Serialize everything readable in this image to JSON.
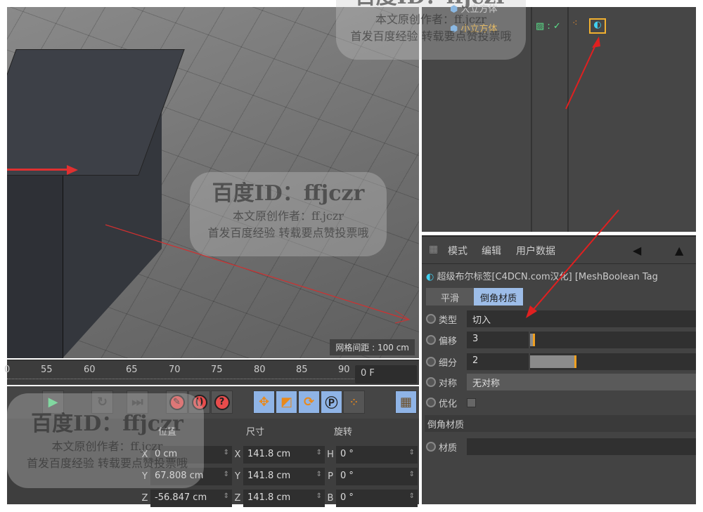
{
  "viewport": {
    "grid_spacing_label": "网格间距 : 100 cm"
  },
  "timeline": {
    "ticks": [
      "0",
      "55",
      "60",
      "65",
      "70",
      "75",
      "80",
      "85",
      "90"
    ],
    "current_frame": "0 F"
  },
  "transport": {
    "icons": [
      "play-icon",
      "record-icon",
      "autokey-icon",
      "help-icon",
      "move-icon",
      "scale-icon",
      "rotate-icon",
      "param-icon",
      "dots-icon",
      "film-icon"
    ],
    "accent": "#8fb4e6"
  },
  "coords": {
    "headers": {
      "position": "位置",
      "size": "尺寸",
      "rotation": "旋转"
    },
    "rows": [
      {
        "pl": "X",
        "pv": "0 cm",
        "sl": "X",
        "sv": "141.8 cm",
        "rl": "H",
        "rv": "0 °"
      },
      {
        "pl": "Y",
        "pv": "67.808 cm",
        "sl": "Y",
        "sv": "141.8 cm",
        "rl": "P",
        "rv": "0 °"
      },
      {
        "pl": "Z",
        "pv": "-56.847 cm",
        "sl": "Z",
        "sv": "141.8 cm",
        "rl": "B",
        "rv": "0 °"
      }
    ]
  },
  "objects": [
    {
      "name": "大立方体"
    },
    {
      "name": "小立方体",
      "selected_color": "#f0b030"
    }
  ],
  "attributes": {
    "menu": [
      "模式",
      "编辑",
      "用户数据"
    ],
    "tag_title": "超级布尔标签[C4DCN.com汉化] [MeshBoolean Tag",
    "tabs": [
      "平滑",
      "倒角材质"
    ],
    "fields": [
      {
        "label": "类型",
        "value": "切入"
      },
      {
        "label": "偏移",
        "value": "3",
        "slider": 0.03
      },
      {
        "label": "细分",
        "value": "2",
        "slider": 0.28
      },
      {
        "label": "对称",
        "value": "无对称"
      },
      {
        "label": "优化",
        "checked": false
      }
    ],
    "section": "倒角材质",
    "material_label": "材质"
  },
  "watermark": {
    "id": "百度ID：ffjczr",
    "line2": "本文原创作者：ff.jczr",
    "line3": "首发百度经验 转载要点赞投票哦"
  }
}
